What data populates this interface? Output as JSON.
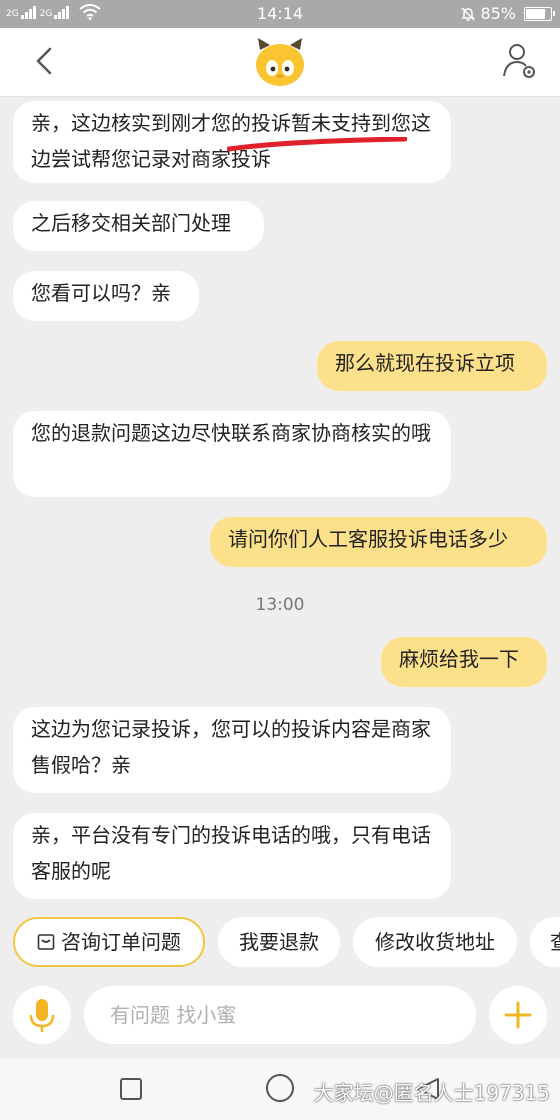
{
  "status_bar": {
    "signal_labels": [
      "2G",
      "2G"
    ],
    "time": "14:14",
    "battery": "85%",
    "battery_level": 0.85
  },
  "header": {
    "back_icon": "chevron-left-icon",
    "logo_icon": "mascot-logo-icon",
    "profile_icon": "user-settings-icon"
  },
  "messages": [
    {
      "side": "in",
      "text": "亲，这边核实到刚才您的投诉暂未支持到您这边尝试帮您记录对商家投诉"
    },
    {
      "side": "in",
      "text": "之后移交相关部门处理"
    },
    {
      "side": "in",
      "text": "您看可以吗？亲"
    },
    {
      "side": "out",
      "text": "那么就现在投诉立项"
    },
    {
      "side": "in",
      "text": "您的退款问题这边尽快联系商家协商核实的哦"
    },
    {
      "side": "out",
      "text": "请问你们人工客服投诉电话多少"
    },
    {
      "side": "time",
      "text": "13:00"
    },
    {
      "side": "out",
      "text": "麻烦给我一下"
    },
    {
      "side": "in",
      "text": "这边为您记录投诉，您可以的投诉内容是商家售假哈？亲"
    },
    {
      "side": "in",
      "text": "亲，平台没有专门的投诉电话的哦，只有电话客服的呢"
    }
  ],
  "quick_replies": [
    "咨询订单问题",
    "我要退款",
    "修改收货地址",
    "查"
  ],
  "input": {
    "placeholder": "有问题 找小蜜"
  },
  "watermark": "大家坛@匿名人士197315",
  "colors": {
    "accent": "#f3c542",
    "outgoing_bubble": "#fde18a",
    "incoming_bubble": "#ffffff",
    "background": "#eeeeee",
    "underline_mark": "#e0202a"
  }
}
